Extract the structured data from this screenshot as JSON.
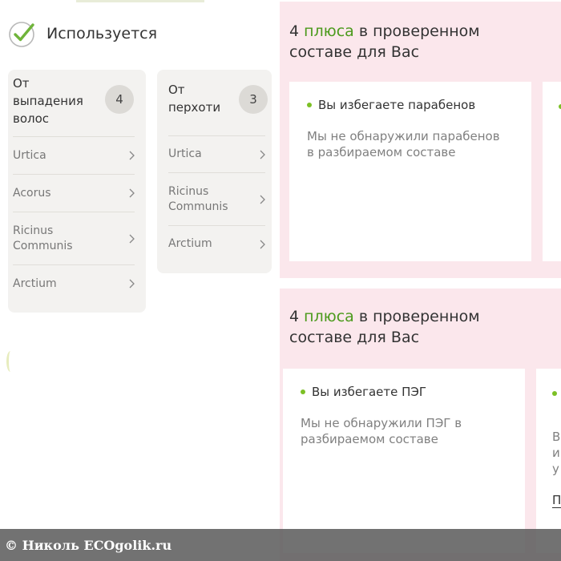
{
  "used": {
    "title": "Используется",
    "icon": "check-circle-icon"
  },
  "categories": [
    {
      "title": "От выпадения волос",
      "count": "4",
      "items": [
        "Urtica",
        "Acorus",
        "Ricinus Communis",
        "Arctium"
      ]
    },
    {
      "title": "От перхоти",
      "count": "3",
      "items": [
        "Urtica",
        "Ricinus Communis",
        "Arctium"
      ]
    }
  ],
  "benefits": [
    {
      "title_prefix": "4 ",
      "title_highlight": "плюса",
      "title_suffix": " в проверенном составе для Вас",
      "card_title": "Вы избегаете парабенов",
      "card_text": "Мы не обнаружили парабенов в разбираемом составе"
    },
    {
      "title_prefix": "4 ",
      "title_highlight": "плюса",
      "title_suffix": " в проверенном составе для Вас",
      "card_title": "Вы избегаете ПЭГ",
      "card_text": "Мы не обнаружили ПЭГ в разбираемом составе",
      "partial_text": "В\nи\nу",
      "partial_link": "П"
    }
  ],
  "watermark": {
    "text": "© Николь ECOgolik.ru"
  },
  "colors": {
    "accent_green": "#4b9a1c",
    "dot_green": "#7cc025",
    "panel_pink": "#fbe7ec",
    "card_gray": "#f3f2f0"
  }
}
